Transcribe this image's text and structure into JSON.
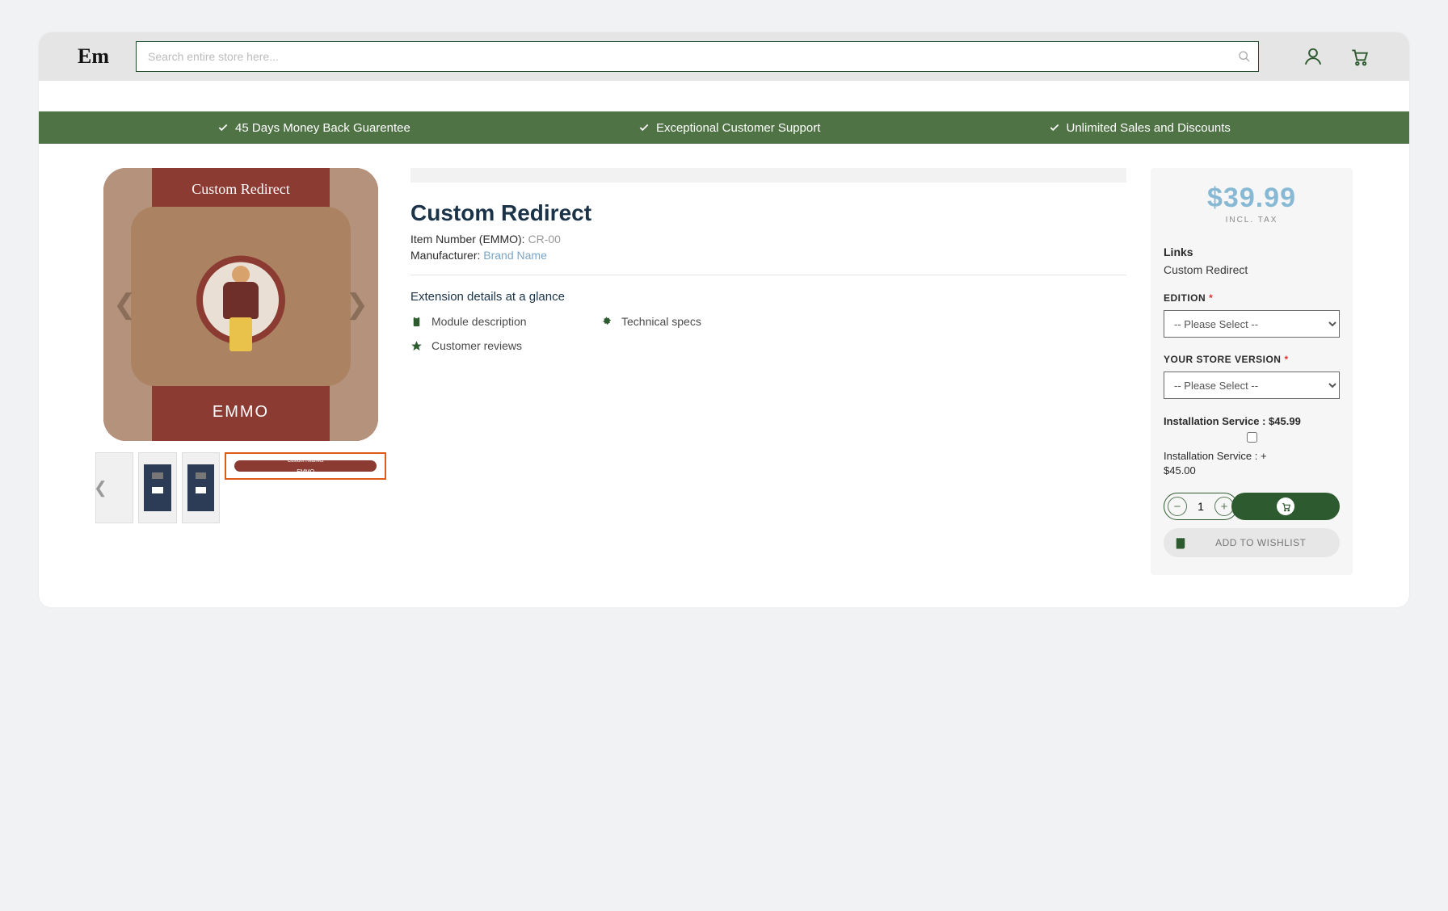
{
  "header": {
    "logo": "Em",
    "search_placeholder": "Search entire store here..."
  },
  "benefits": {
    "one": "45 Days Money Back Guarentee",
    "two": "Exceptional Customer Support",
    "three": "Unlimited Sales and Discounts"
  },
  "gallery": {
    "tile_title": "Custom Redirect",
    "tile_footer": "EMMO"
  },
  "product": {
    "title": "Custom Redirect",
    "item_label": "Item Number (EMMO):",
    "item_value": "CR-00",
    "manu_label": "Manufacturer:",
    "manu_value": "Brand Name",
    "glance_heading": "Extension details at a glance",
    "glance": {
      "module": "Module description",
      "tech": "Technical specs",
      "reviews": "Customer reviews"
    }
  },
  "purchase": {
    "price": "$39.99",
    "taxline": "INCL. TAX",
    "links_label": "Links",
    "links_value": "Custom Redirect",
    "edition_label": "EDITION",
    "store_ver_label": "YOUR STORE VERSION",
    "select_placeholder": "-- Please Select --",
    "install_heading": "Installation Service : $45.99",
    "install_line1": "Installation Service : +",
    "install_line2": "$45.00",
    "qty": "1",
    "wishlist": "ADD TO WISHLIST"
  }
}
